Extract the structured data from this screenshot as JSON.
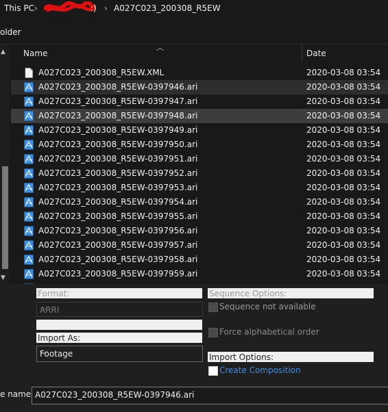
{
  "breadcrumb": {
    "this_pc": "This PC",
    "sep1": "›",
    "drive_suffix": ":)",
    "sep2": "›",
    "folder": "A027C023_200308_R5EW"
  },
  "toolbar": {
    "label": "older"
  },
  "columns": {
    "name": "Name",
    "date": "Date"
  },
  "files": [
    {
      "name": "A027C023_200308_R5EW.XML",
      "date": "2020-03-08 03:54",
      "type": "xml"
    },
    {
      "name": "A027C023_200308_R5EW-0397946.ari",
      "date": "2020-03-08 03:54",
      "type": "ari",
      "state": "selected"
    },
    {
      "name": "A027C023_200308_R5EW-0397947.ari",
      "date": "2020-03-08 03:54",
      "type": "ari"
    },
    {
      "name": "A027C023_200308_R5EW-0397948.ari",
      "date": "2020-03-08 03:54",
      "type": "ari",
      "state": "hover"
    },
    {
      "name": "A027C023_200308_R5EW-0397949.ari",
      "date": "2020-03-08 03:54",
      "type": "ari"
    },
    {
      "name": "A027C023_200308_R5EW-0397950.ari",
      "date": "2020-03-08 03:54",
      "type": "ari"
    },
    {
      "name": "A027C023_200308_R5EW-0397951.ari",
      "date": "2020-03-08 03:54",
      "type": "ari"
    },
    {
      "name": "A027C023_200308_R5EW-0397952.ari",
      "date": "2020-03-08 03:54",
      "type": "ari"
    },
    {
      "name": "A027C023_200308_R5EW-0397953.ari",
      "date": "2020-03-08 03:54",
      "type": "ari"
    },
    {
      "name": "A027C023_200308_R5EW-0397954.ari",
      "date": "2020-03-08 03:54",
      "type": "ari"
    },
    {
      "name": "A027C023_200308_R5EW-0397955.ari",
      "date": "2020-03-08 03:54",
      "type": "ari"
    },
    {
      "name": "A027C023_200308_R5EW-0397956.ari",
      "date": "2020-03-08 03:54",
      "type": "ari"
    },
    {
      "name": "A027C023_200308_R5EW-0397957.ari",
      "date": "2020-03-08 03:54",
      "type": "ari"
    },
    {
      "name": "A027C023_200308_R5EW-0397958.ari",
      "date": "2020-03-08 03:54",
      "type": "ari"
    },
    {
      "name": "A027C023_200308_R5EW-0397959.ari",
      "date": "2020-03-08 03:54",
      "type": "ari"
    }
  ],
  "options": {
    "format_label": "Format:",
    "format_value": "ARRI",
    "import_as_label": "Import As:",
    "import_as_value": "Footage",
    "sequence_options_label": "Sequence Options:",
    "sequence_not_available": "Sequence not available",
    "force_alphabetical": "Force alphabetical order",
    "import_options_label": "Import Options:",
    "create_composition": "Create Composition"
  },
  "filename": {
    "label": "e name:",
    "value": "A027C023_200308_R5EW-0397946.ari"
  },
  "colors": {
    "background": "#191919",
    "selected_row": "#2e2e2e",
    "hover_row": "#3d3d3d",
    "ari_icon": "#3c8fe0",
    "link": "#3f8fe8",
    "field_bg": "#efefef"
  },
  "icons": {
    "xml": "document-icon",
    "ari": "ari-file-icon",
    "sort": "chevron-up-icon",
    "dropdown": "chevron-down-icon"
  }
}
